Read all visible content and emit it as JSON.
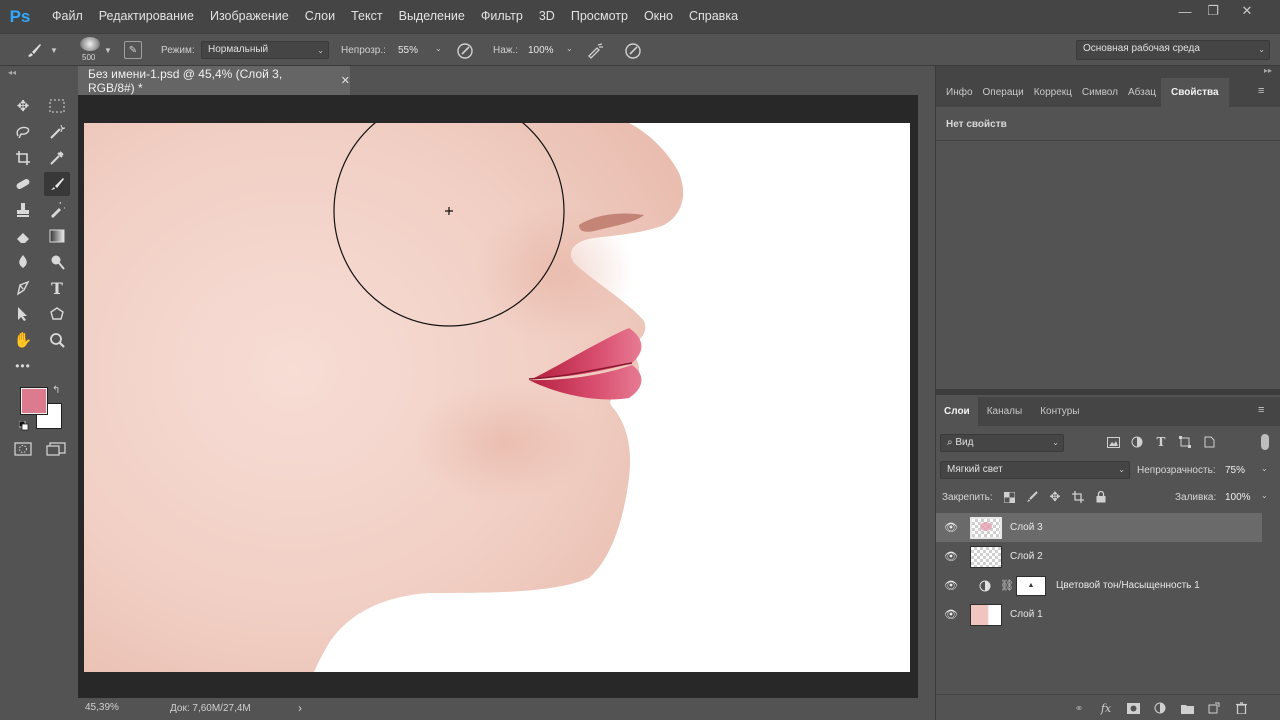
{
  "app": {
    "logo": "Ps"
  },
  "menu": [
    "Файл",
    "Редактирование",
    "Изображение",
    "Слои",
    "Текст",
    "Выделение",
    "Фильтр",
    "3D",
    "Просмотр",
    "Окно",
    "Справка"
  ],
  "window_controls": {
    "minimize": "—",
    "restore": "❐",
    "close": "✕"
  },
  "options": {
    "brush_size": "500",
    "mode_label": "Режим:",
    "mode_value": "Нормальный",
    "opacity_label": "Непрозр.:",
    "opacity_value": "55%",
    "flow_label": "Наж.:",
    "flow_value": "100%",
    "workspace_value": "Основная рабочая среда"
  },
  "document": {
    "tab_title": "Без имени-1.psd @ 45,4% (Слой 3, RGB/8#) *",
    "close": "✕",
    "zoom": "45,39%",
    "doc_info": "Док: 7,60M/27,4M",
    "status_arrow": "›"
  },
  "properties_panel": {
    "tabs": [
      "Инфо",
      "Операци",
      "Коррекц",
      "Символ",
      "Абзац",
      "Свойства"
    ],
    "active_tab": "Свойства",
    "empty_text": "Нет свойств"
  },
  "layers_panel": {
    "tabs": [
      "Слои",
      "Каналы",
      "Контуры"
    ],
    "active_tab": "Слои",
    "filter_value": "Вид",
    "blend_mode": "Мягкий свет",
    "opacity_label": "Непрозрачность:",
    "opacity_value": "75%",
    "lock_label": "Закрепить:",
    "fill_label": "Заливка:",
    "fill_value": "100%",
    "layers": [
      {
        "name": "Слой 3",
        "kind": "pixel",
        "selected": true
      },
      {
        "name": "Слой 2",
        "kind": "pixel",
        "selected": false
      },
      {
        "name": "Цветовой тон/Насыщенность 1",
        "kind": "adjustment",
        "selected": false
      },
      {
        "name": "Слой 1",
        "kind": "photo",
        "selected": false
      }
    ]
  },
  "colors": {
    "foreground": "#dc7a8e",
    "background": "#ffffff",
    "accent": "#31a8ff"
  },
  "toolbar_icons": [
    "move-icon",
    "marquee-icon",
    "lasso-icon",
    "magic-wand-icon",
    "crop-icon",
    "eyedropper-icon",
    "healing-brush-icon",
    "brush-icon",
    "clone-stamp-icon",
    "history-brush-icon",
    "eraser-icon",
    "gradient-icon",
    "blur-icon",
    "dodge-icon",
    "pen-icon",
    "type-icon",
    "path-selection-icon",
    "shape-icon",
    "hand-icon",
    "zoom-icon",
    "more-tools-icon"
  ]
}
